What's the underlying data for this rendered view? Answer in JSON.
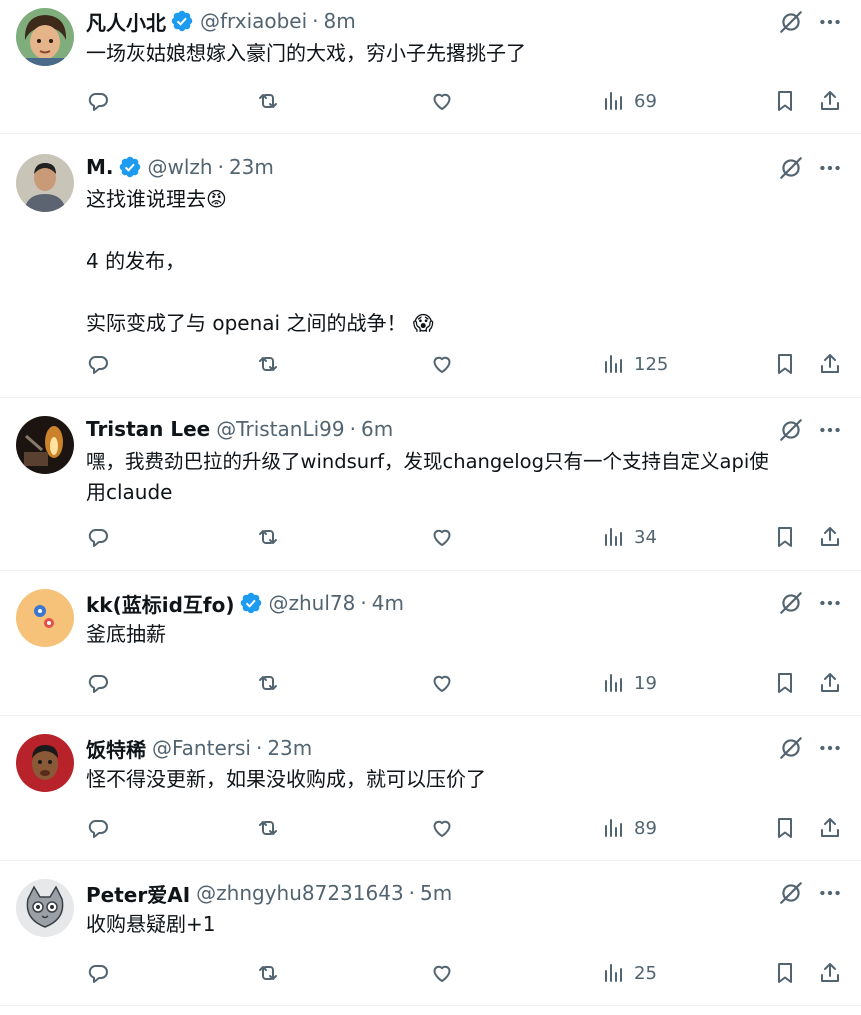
{
  "colors": {
    "text": "#0f1419",
    "muted": "#536471",
    "verified": "#1d9bf0",
    "divider": "#eff3f4"
  },
  "icons": {
    "verified": "verified-badge-icon",
    "grok": "grok-icon",
    "more": "more-options-icon",
    "reply": "reply-icon",
    "retweet": "retweet-icon",
    "like": "like-icon",
    "views": "views-icon",
    "bookmark": "bookmark-icon",
    "share": "share-icon"
  },
  "tweets": [
    {
      "name": "凡人小北",
      "verified": true,
      "handle": "@frxiaobei",
      "sep": "·",
      "time": "8m",
      "lines": [
        "一场灰姑娘想嫁入豪门的大戏，穷小子先撂挑子了"
      ],
      "views": "69"
    },
    {
      "name": "M.",
      "verified": true,
      "handle": "@wlzh",
      "sep": "·",
      "time": "23m",
      "lines": [
        "这找谁说理去😡",
        "",
        "4 的发布，",
        "",
        "实际变成了与 openai 之间的战争！ 😱"
      ],
      "views": "125"
    },
    {
      "name": "Tristan Lee",
      "verified": false,
      "handle": "@TristanLi99",
      "sep": "·",
      "time": "6m",
      "lines": [
        "嘿，我费劲巴拉的升级了windsurf，发现changelog只有一个支持自定义api使",
        "用claude"
      ],
      "views": "34"
    },
    {
      "name": "kk(蓝标id互fo)",
      "verified": true,
      "handle": "@zhul78",
      "sep": "·",
      "time": "4m",
      "lines": [
        "釜底抽薪"
      ],
      "views": "19"
    },
    {
      "name": "饭特稀",
      "verified": false,
      "handle": "@Fantersi",
      "sep": "·",
      "time": "23m",
      "lines": [
        "怪不得没更新，如果没收购成，就可以压价了"
      ],
      "views": "89"
    },
    {
      "name": "Peter爱AI",
      "verified": false,
      "handle": "@zhngyhu87231643",
      "sep": "·",
      "time": "5m",
      "lines": [
        "收购悬疑剧+1"
      ],
      "views": "25"
    }
  ]
}
